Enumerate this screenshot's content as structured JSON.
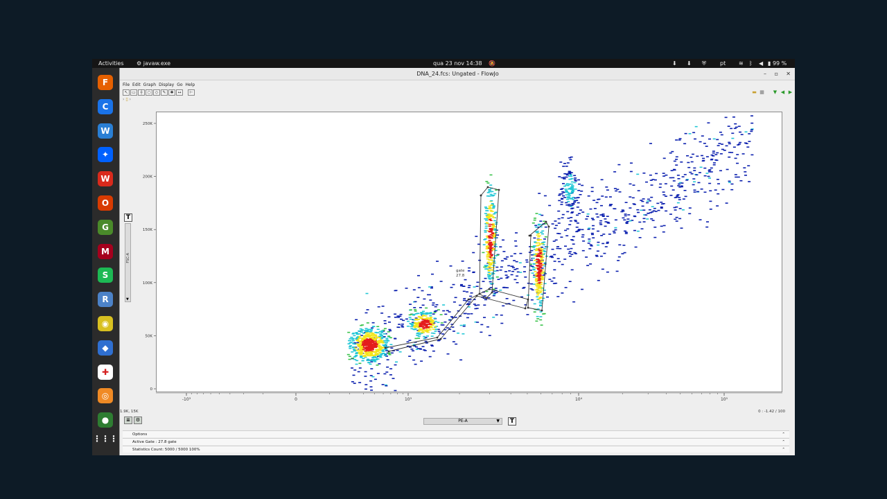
{
  "topbar": {
    "activities": "Activities",
    "app_name": "javaw.exe",
    "datetime": "qua 23 nov  14:38",
    "lang": "pt",
    "battery": "99 %"
  },
  "dock": {
    "items": [
      {
        "name": "firefox-icon",
        "color": "#e66000",
        "glyph": "F"
      },
      {
        "name": "chrome-icon",
        "color": "#1a73e8",
        "glyph": "C"
      },
      {
        "name": "libreoffice-writer-icon",
        "color": "#2a7fd4",
        "glyph": "W"
      },
      {
        "name": "dropbox-icon",
        "color": "#0061fe",
        "glyph": "✦"
      },
      {
        "name": "wps-office-icon",
        "color": "#d92a1c",
        "glyph": "W"
      },
      {
        "name": "office-icon",
        "color": "#d83b01",
        "glyph": "O"
      },
      {
        "name": "gnumeric-icon",
        "color": "#4a8a2a",
        "glyph": "G"
      },
      {
        "name": "mendeley-icon",
        "color": "#a5001d",
        "glyph": "M"
      },
      {
        "name": "spotify-icon",
        "color": "#1db954",
        "glyph": "S"
      },
      {
        "name": "r-icon",
        "color": "#4c82c7",
        "glyph": "R"
      },
      {
        "name": "rhythmbox-icon",
        "color": "#d8c020",
        "glyph": "◉"
      },
      {
        "name": "git-icon",
        "color": "#2f6fd0",
        "glyph": "◆"
      },
      {
        "name": "help-lifebuoy-icon",
        "color": "#ffffff",
        "glyph": "✚"
      },
      {
        "name": "flowjo-icon",
        "color": "#f08a24",
        "glyph": "◎"
      },
      {
        "name": "turtle-icon",
        "color": "#2e7d32",
        "glyph": "●"
      }
    ],
    "apps_grid": "⋮⋮⋮"
  },
  "window": {
    "title": "DNA_24.fcs: Ungated - FlowJo",
    "menu": [
      "File",
      "Edit",
      "Graph",
      "Display",
      "Go",
      "Help"
    ]
  },
  "plot": {
    "y_ticks": [
      "250K",
      "200K",
      "150K",
      "100K",
      "50K",
      "0"
    ],
    "x_ticks": [
      "-10³",
      "0",
      "10³",
      "10⁴",
      "10⁵"
    ],
    "gate_label": "gate",
    "gate_percent": "27.8",
    "y_param": "FSC-A",
    "x_param": "PE-A"
  },
  "footer": {
    "left_info": "1.9K, 15K",
    "right_info": "0 : -1.42 / 100",
    "options": "Options",
    "active_gate": "Active Gate  :  27.8 gate",
    "statistics": "Statistics   Count: 5000 / 5000     100%"
  },
  "colors": {
    "density_low": "#0a1fae",
    "density_mid": "#22c7d6",
    "density_high": "#f4e61c",
    "density_peak": "#e41c1c",
    "gate_line": "#333333"
  }
}
